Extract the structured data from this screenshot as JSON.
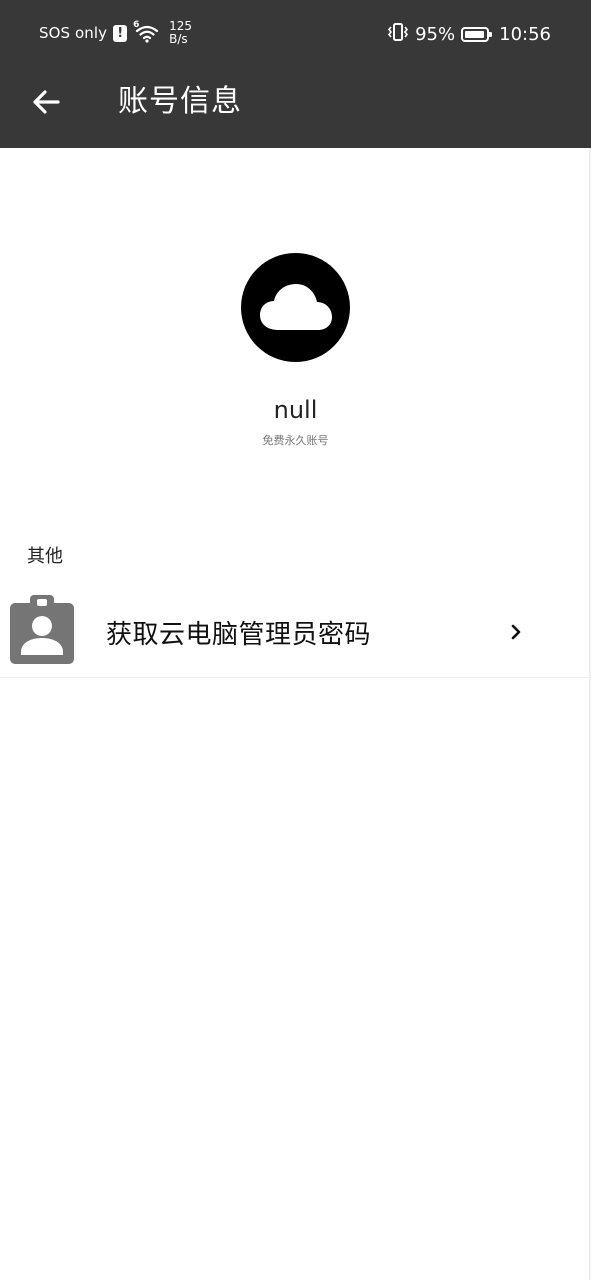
{
  "status_bar": {
    "carrier": "SOS only",
    "sim_alert": "!",
    "wifi_badge": "6",
    "net_speed_value": "125",
    "net_speed_unit": "B/s",
    "battery_percent": "95%",
    "time": "10:56"
  },
  "app_bar": {
    "title": "账号信息",
    "back_icon": "arrow-left-icon"
  },
  "profile": {
    "avatar_icon": "cloud-icon",
    "username": "null",
    "account_type": "免费永久账号"
  },
  "section": {
    "label": "其他",
    "items": [
      {
        "icon": "clipboard-account-icon",
        "label": "获取云电脑管理员密码",
        "chevron_icon": "chevron-right-icon"
      }
    ]
  },
  "colors": {
    "top_bar": "#383838",
    "background": "#ffffff",
    "row_icon": "#757575"
  }
}
